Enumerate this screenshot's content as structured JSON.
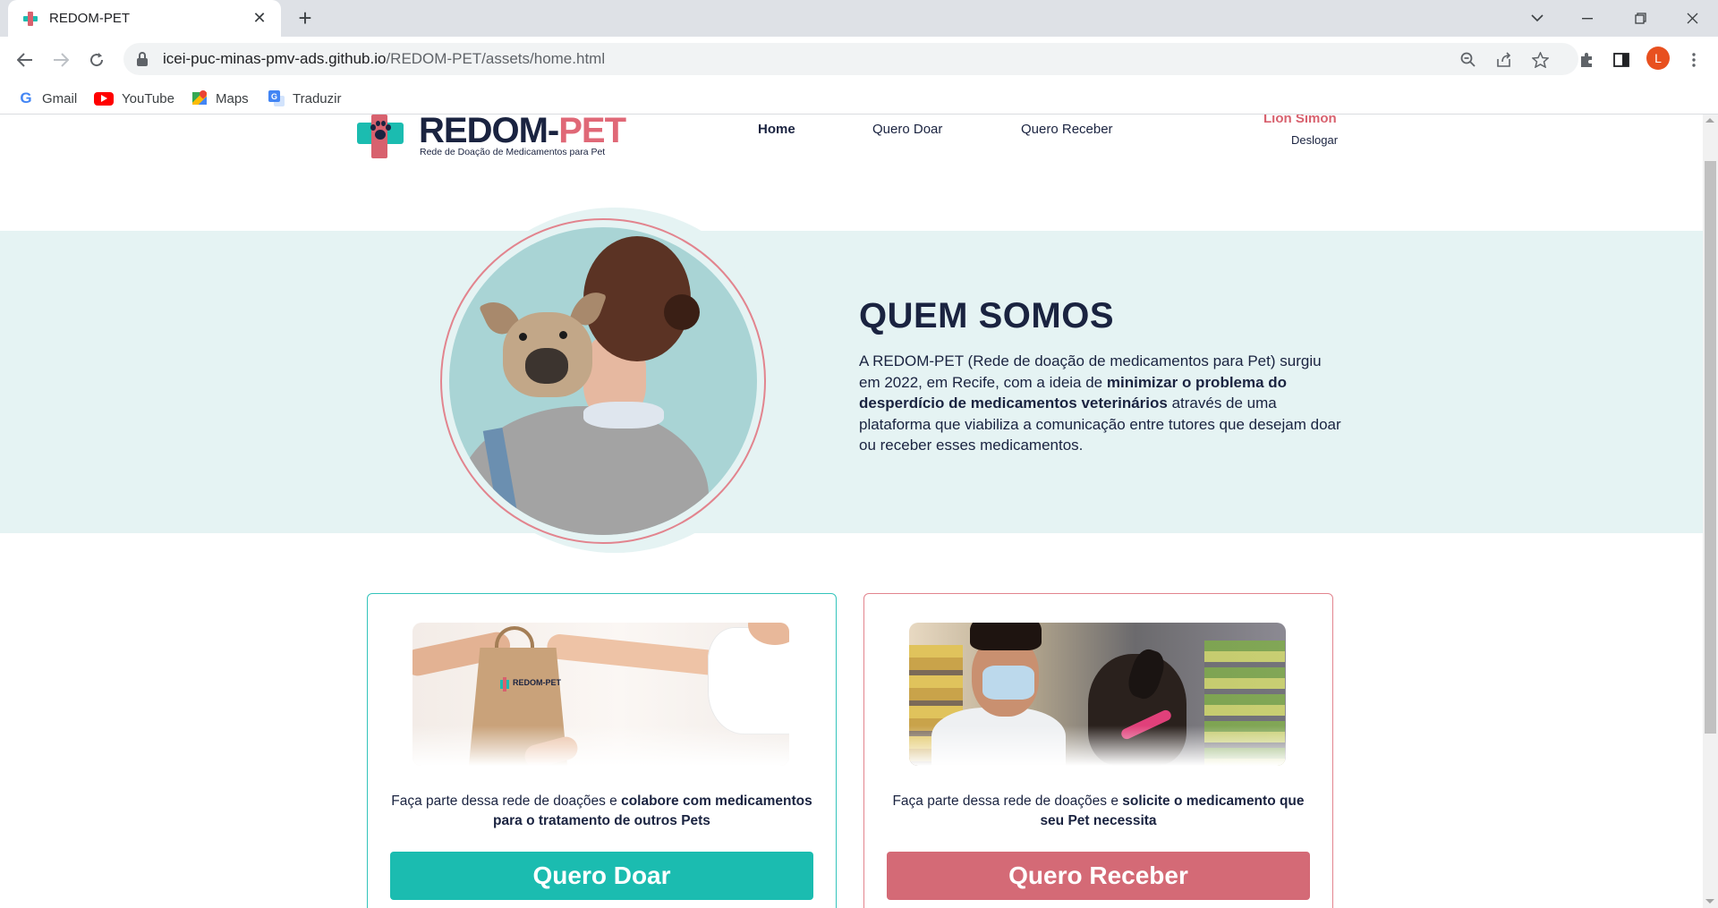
{
  "browser": {
    "tab_title": "REDOM-PET",
    "tab_close": "✕",
    "new_tab": "+",
    "url_host": "icei-puc-minas-pmv-ads.github.io",
    "url_path": "/REDOM-PET/assets/home.html",
    "profile_initial": "L",
    "bookmarks": [
      {
        "label": "Gmail",
        "icon": "google-icon"
      },
      {
        "label": "YouTube",
        "icon": "youtube-icon"
      },
      {
        "label": "Maps",
        "icon": "maps-icon"
      },
      {
        "label": "Traduzir",
        "icon": "translate-icon"
      }
    ]
  },
  "header": {
    "logo_name_main": "REDOM-",
    "logo_name_accent": "PET",
    "logo_tagline": "Rede de Doação de Medicamentos para Pet",
    "nav": [
      {
        "label": "Home",
        "active": true
      },
      {
        "label": "Quero Doar",
        "active": false
      },
      {
        "label": "Quero Receber",
        "active": false
      }
    ],
    "user_name": "Lion Simon",
    "logout_label": "Deslogar"
  },
  "about": {
    "title": "QUEM SOMOS",
    "text_part1": "A REDOM-PET (Rede de doação de medicamentos para Pet) surgiu em 2022, em Recife, com a ideia de ",
    "text_bold": "minimizar o problema do desperdício de medicamentos veterinários",
    "text_part2": " através de uma plataforma que viabiliza a comunicação entre tutores que desejam doar ou receber esses medicamentos."
  },
  "cards": {
    "donate": {
      "text_part1": "Faça parte dessa rede de doações e ",
      "text_bold": "colabore com medicamentos para o tratamento de outros Pets",
      "button": "Quero Doar",
      "bag_logo": "REDOM-PET"
    },
    "receive": {
      "text_part1": "Faça parte dessa rede de doações e ",
      "text_bold": "solicite o medicamento que seu Pet necessita",
      "button": "Quero Receber"
    }
  },
  "colors": {
    "brand_navy": "#1a2340",
    "brand_teal": "#1bbcb0",
    "brand_rose": "#d8616e",
    "hero_band": "#e5f3f3"
  }
}
